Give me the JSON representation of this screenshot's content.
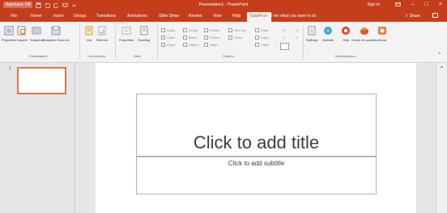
{
  "window": {
    "autosave_label": "AutoSave",
    "autosave_state": "Off",
    "title": "Presentation1 - PowerPoint",
    "signin": "Sign in"
  },
  "tabs": [
    "File",
    "Home",
    "Insert",
    "Design",
    "Transitions",
    "Animations",
    "Slide Show",
    "Review",
    "View",
    "Help",
    "DataPoint"
  ],
  "active_tab": "DataPoint",
  "tell_me": "Tell me what you want to do",
  "share": "Share",
  "ribbon": {
    "groups": {
      "presentation": "Presentation",
      "connections": "Connections",
      "slide": "Slide",
      "shapes": "Shapes",
      "miscellaneous": "Miscellaneous"
    },
    "buttons": {
      "properties": "Properties",
      "inspect": "Inspect",
      "snapshot": "Snapshot",
      "snapshot_save_as": "Snapshot Save As",
      "list": "List",
      "refresh": "Refresh",
      "slide_properties": "Properties",
      "scrolling": "Scrolling",
      "settings": "Settings",
      "website": "Website",
      "help": "Help",
      "check_updates": "Check for updates",
      "about": "About"
    },
    "shapes_small": {
      "audio": "Audio",
      "graph": "Graph",
      "pointer": "Pointer",
      "text_box": "Text box",
      "chart": "Chart",
      "meter": "Meter",
      "picture": "Picture",
      "video": "Video",
      "clock": "Clock",
      "object": "Object",
      "table": "Table",
      "clear": "Clear",
      "copy": "Copy",
      "paste": "Paste",
      "plus1": "+1",
      "minus1": "-1",
      "plusx": "+X",
      "minusx": "-X"
    }
  },
  "thumbnail": {
    "number": "1"
  },
  "slide": {
    "title_placeholder": "Click to add title",
    "subtitle_placeholder": "Click to add subtitle"
  },
  "colors": {
    "accent": "#c43e1c",
    "ribbon_bg": "#f3f3f3",
    "thumb_border": "#e0734f"
  }
}
